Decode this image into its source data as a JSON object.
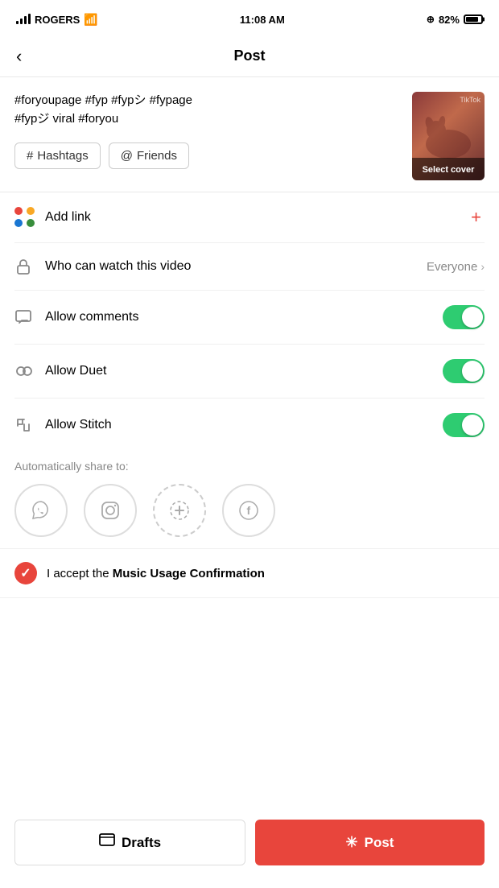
{
  "statusBar": {
    "carrier": "ROGERS",
    "time": "11:08 AM",
    "battery": "82%"
  },
  "header": {
    "title": "Post",
    "backLabel": "<"
  },
  "caption": {
    "text": "#foryoupage #fyp #fypシ #fypage\n#fypジ viral #foryou",
    "hashtagsBtn": "# Hashtags",
    "friendsBtn": "@ Friends",
    "selectCover": "Select cover"
  },
  "addLink": {
    "label": "Add link",
    "plusIcon": "+"
  },
  "watchSetting": {
    "label": "Who can watch this video",
    "value": "Everyone",
    "chevron": "›"
  },
  "allowComments": {
    "label": "Allow comments",
    "enabled": true
  },
  "allowDuet": {
    "label": "Allow Duet",
    "enabled": true
  },
  "allowStitch": {
    "label": "Allow Stitch",
    "enabled": true
  },
  "shareSection": {
    "label": "Automatically share to:",
    "icons": [
      {
        "name": "whatsapp",
        "symbol": "◉"
      },
      {
        "name": "instagram",
        "symbol": "⬜"
      },
      {
        "name": "tiktok-plus",
        "symbol": "⊕"
      },
      {
        "name": "facebook",
        "symbol": "f"
      }
    ]
  },
  "musicRow": {
    "prefix": "I accept the ",
    "bold": "Music Usage Confirmation"
  },
  "bottomBar": {
    "draftsIcon": "▭",
    "draftsLabel": "Drafts",
    "postIcon": "✳",
    "postLabel": "Post"
  }
}
